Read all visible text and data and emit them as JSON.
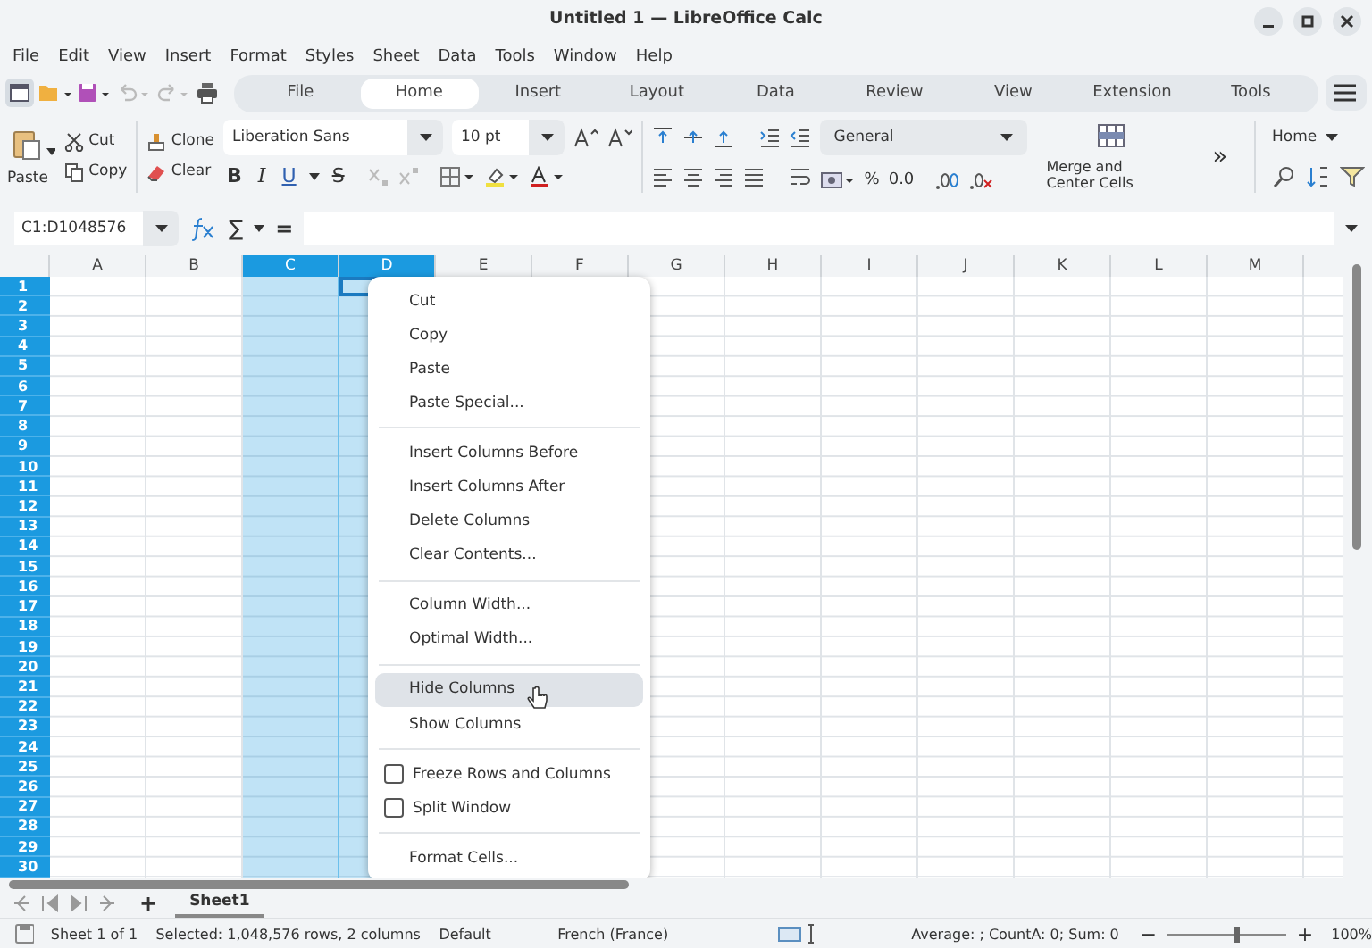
{
  "window": {
    "title": "Untitled 1 — LibreOffice Calc"
  },
  "menu_bar": [
    "File",
    "Edit",
    "View",
    "Insert",
    "Format",
    "Styles",
    "Sheet",
    "Data",
    "Tools",
    "Window",
    "Help"
  ],
  "tabs": [
    {
      "label": "File",
      "selected": false
    },
    {
      "label": "Home",
      "selected": true
    },
    {
      "label": "Insert",
      "selected": false
    },
    {
      "label": "Layout",
      "selected": false
    },
    {
      "label": "Data",
      "selected": false
    },
    {
      "label": "Review",
      "selected": false
    },
    {
      "label": "View",
      "selected": false
    },
    {
      "label": "Extension",
      "selected": false
    },
    {
      "label": "Tools",
      "selected": false
    }
  ],
  "toolbar": {
    "paste": "Paste",
    "cut": "Cut",
    "copy": "Copy",
    "clone": "Clone",
    "clear": "Clear",
    "font_name": "Liberation Sans",
    "font_size": "10 pt",
    "text_format": [
      "B",
      "I",
      "U",
      "S"
    ],
    "number_format": "General",
    "percent": "%",
    "decimal": "0.0",
    "merge": "Merge and Center Cells",
    "more": "»",
    "style_name": "Home"
  },
  "formula_bar": {
    "name_box": "C1:D1048576",
    "sum": "∑",
    "equals": "="
  },
  "sheet": {
    "columns": [
      {
        "label": "A",
        "selected": false,
        "cursor": false
      },
      {
        "label": "B",
        "selected": false,
        "cursor": false
      },
      {
        "label": "C",
        "selected": true,
        "cursor": false
      },
      {
        "label": "D",
        "selected": true,
        "cursor": true
      },
      {
        "label": "E",
        "selected": false,
        "cursor": false
      },
      {
        "label": "F",
        "selected": false,
        "cursor": false
      },
      {
        "label": "G",
        "selected": false,
        "cursor": false
      },
      {
        "label": "H",
        "selected": false,
        "cursor": false
      },
      {
        "label": "I",
        "selected": false,
        "cursor": false
      },
      {
        "label": "J",
        "selected": false,
        "cursor": false
      },
      {
        "label": "K",
        "selected": false,
        "cursor": false
      },
      {
        "label": "L",
        "selected": false,
        "cursor": false
      },
      {
        "label": "M",
        "selected": false,
        "cursor": false
      }
    ],
    "rows": [
      {
        "label": "1",
        "selected": true,
        "cursor": true
      },
      {
        "label": "2",
        "selected": true,
        "cursor": false
      },
      {
        "label": "3",
        "selected": true,
        "cursor": false
      },
      {
        "label": "4",
        "selected": true,
        "cursor": false
      },
      {
        "label": "5",
        "selected": true,
        "cursor": false
      },
      {
        "label": "6",
        "selected": true,
        "cursor": false
      },
      {
        "label": "7",
        "selected": true,
        "cursor": false
      },
      {
        "label": "8",
        "selected": true,
        "cursor": false
      },
      {
        "label": "9",
        "selected": true,
        "cursor": false
      },
      {
        "label": "10",
        "selected": true,
        "cursor": false
      },
      {
        "label": "11",
        "selected": true,
        "cursor": false
      },
      {
        "label": "12",
        "selected": true,
        "cursor": false
      },
      {
        "label": "13",
        "selected": true,
        "cursor": false
      },
      {
        "label": "14",
        "selected": true,
        "cursor": false
      },
      {
        "label": "15",
        "selected": true,
        "cursor": false
      },
      {
        "label": "16",
        "selected": true,
        "cursor": false
      },
      {
        "label": "17",
        "selected": true,
        "cursor": false
      },
      {
        "label": "18",
        "selected": true,
        "cursor": false
      },
      {
        "label": "19",
        "selected": true,
        "cursor": false
      },
      {
        "label": "20",
        "selected": true,
        "cursor": false
      },
      {
        "label": "21",
        "selected": true,
        "cursor": false
      },
      {
        "label": "22",
        "selected": true,
        "cursor": false
      },
      {
        "label": "23",
        "selected": true,
        "cursor": false
      },
      {
        "label": "24",
        "selected": true,
        "cursor": false
      },
      {
        "label": "25",
        "selected": true,
        "cursor": false
      },
      {
        "label": "26",
        "selected": true,
        "cursor": false
      },
      {
        "label": "27",
        "selected": true,
        "cursor": false
      },
      {
        "label": "28",
        "selected": true,
        "cursor": false
      },
      {
        "label": "29",
        "selected": true,
        "cursor": false
      },
      {
        "label": "30",
        "selected": true,
        "cursor": false
      }
    ]
  },
  "context_menu": {
    "items": [
      {
        "kind": "item",
        "label": "Cut",
        "highlighted": false
      },
      {
        "kind": "item",
        "label": "Copy",
        "highlighted": false
      },
      {
        "kind": "item",
        "label": "Paste",
        "highlighted": false
      },
      {
        "kind": "item",
        "label": "Paste Special...",
        "highlighted": false
      },
      {
        "kind": "separator"
      },
      {
        "kind": "item",
        "label": "Insert Columns Before",
        "highlighted": false
      },
      {
        "kind": "item",
        "label": "Insert Columns After",
        "highlighted": false
      },
      {
        "kind": "item",
        "label": "Delete Columns",
        "highlighted": false
      },
      {
        "kind": "item",
        "label": "Clear Contents...",
        "highlighted": false
      },
      {
        "kind": "separator"
      },
      {
        "kind": "item",
        "label": "Column Width...",
        "highlighted": false
      },
      {
        "kind": "item",
        "label": "Optimal Width...",
        "highlighted": false
      },
      {
        "kind": "separator"
      },
      {
        "kind": "item",
        "label": "Hide Columns",
        "highlighted": true
      },
      {
        "kind": "item",
        "label": "Show Columns",
        "highlighted": false
      },
      {
        "kind": "separator"
      },
      {
        "kind": "check",
        "label": "Freeze Rows and Columns",
        "checked": false
      },
      {
        "kind": "check",
        "label": "Split Window",
        "checked": false
      },
      {
        "kind": "separator"
      },
      {
        "kind": "item",
        "label": "Format Cells...",
        "highlighted": false
      }
    ]
  },
  "sheet_tabs": {
    "add": "+",
    "tabs": [
      {
        "label": "Sheet1",
        "selected": true
      }
    ]
  },
  "status_bar": {
    "sheet": "Sheet 1 of 1",
    "selection": "Selected: 1,048,576 rows, 2 columns",
    "style": "Default",
    "language": "French (France)",
    "summary": "Average: ; CountA: 0; Sum: 0",
    "zoom_minus": "−",
    "zoom_plus": "+",
    "zoom": {
      "level": 0.58
    },
    "zoom_text": "100%"
  }
}
